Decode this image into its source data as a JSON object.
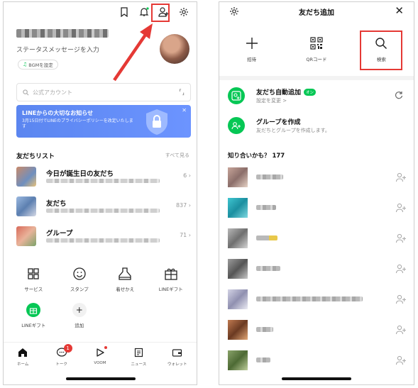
{
  "left": {
    "status_message": "ステータスメッセージを入力",
    "bgm_label": "BGMを設定",
    "search_placeholder": "公式アカウント",
    "banner": {
      "title": "LINEからの大切なお知らせ",
      "body": "3月15日付でLINEのプライバシーポリシーを改定いたします"
    },
    "friends_list": {
      "title": "友だちリスト",
      "see_all": "すべて見る",
      "rows": [
        {
          "name": "今日が誕生日の友だち",
          "count": "6"
        },
        {
          "name": "友だち",
          "count": "837"
        },
        {
          "name": "グループ",
          "count": "71"
        }
      ]
    },
    "grid": [
      {
        "label": "サービス",
        "icon": "services-icon"
      },
      {
        "label": "スタンプ",
        "icon": "sticker-icon"
      },
      {
        "label": "着せかえ",
        "icon": "theme-icon"
      },
      {
        "label": "LINEギフト",
        "icon": "gift-icon"
      },
      {
        "label": "LINEギフト",
        "icon": "gift-green-icon"
      },
      {
        "label": "追加",
        "icon": "add-icon"
      }
    ],
    "tabs": [
      {
        "label": "ホーム",
        "icon": "home-icon"
      },
      {
        "label": "トーク",
        "icon": "chat-icon",
        "badge": "1"
      },
      {
        "label": "VOOM",
        "icon": "voom-icon"
      },
      {
        "label": "ニュース",
        "icon": "news-icon"
      },
      {
        "label": "ウォレット",
        "icon": "wallet-icon"
      }
    ]
  },
  "right": {
    "title": "友だち追加",
    "actions": [
      {
        "label": "招待",
        "icon": "invite-plus-icon"
      },
      {
        "label": "QRコード",
        "icon": "qr-code-icon"
      },
      {
        "label": "検索",
        "icon": "search-icon"
      }
    ],
    "auto_add": {
      "title": "友だち自動追加",
      "on": "オン",
      "sub": "設定を変更 >"
    },
    "create_group": {
      "title": "グループを作成",
      "sub": "友だちとグループを作成します。"
    },
    "suggest_title": "知り合いかも？ 177"
  },
  "colors": {
    "line_green": "#06c755",
    "highlight_red": "#e53935",
    "banner_blue": "#5b86f0"
  }
}
